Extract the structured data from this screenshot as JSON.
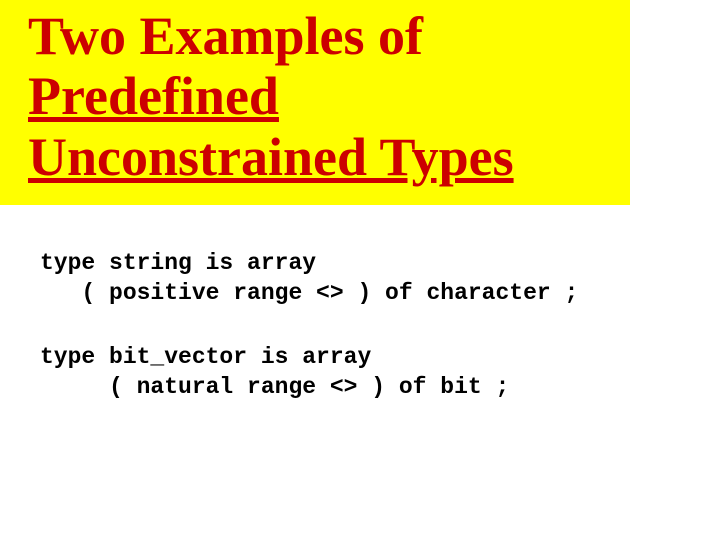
{
  "title": {
    "part1": "Two Examples of ",
    "underlined1": "Predefined",
    "part2": "Unconstrained Types"
  },
  "code": {
    "block1_line1": "type string is array",
    "block1_line2": "   ( positive range <> ) of character ;",
    "block2_line1": "type bit_vector is array",
    "block2_line2": "     ( natural range <> ) of bit ;"
  }
}
